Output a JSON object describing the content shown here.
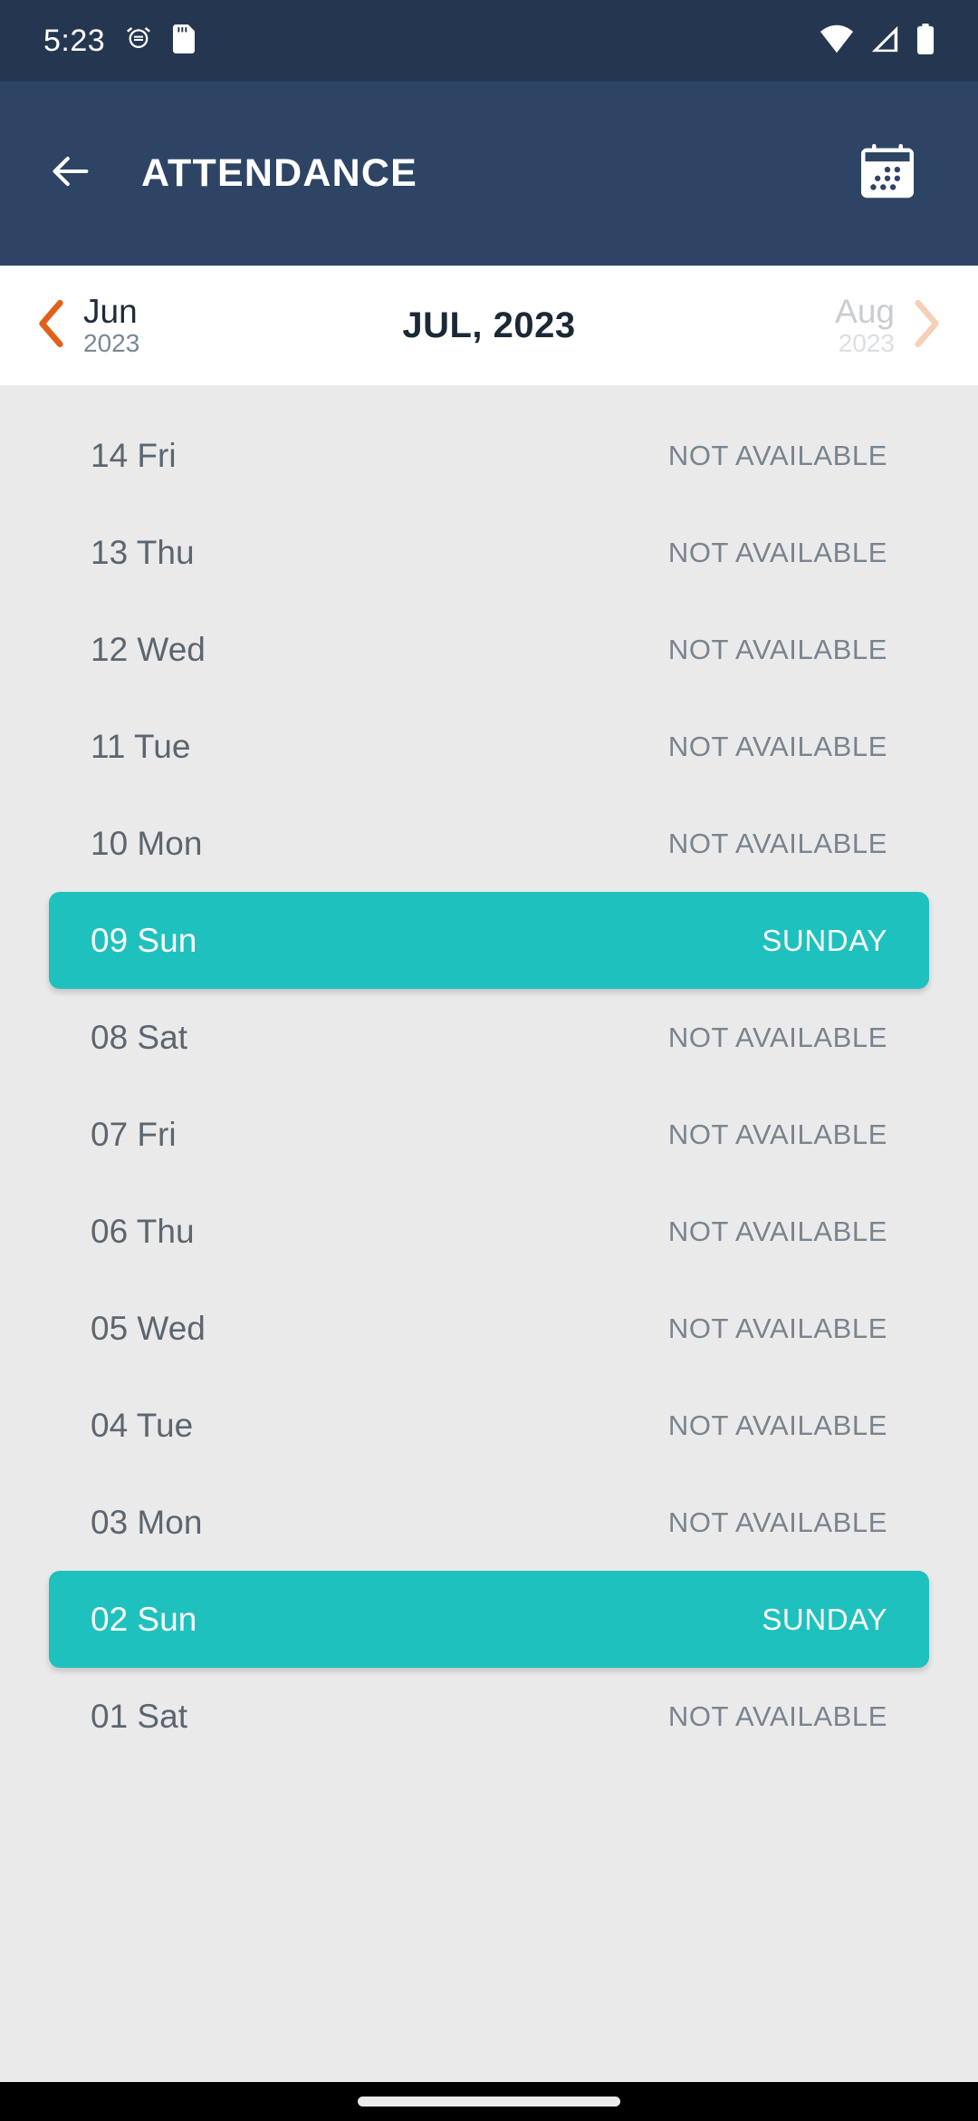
{
  "status_bar": {
    "time": "5:23",
    "icons": [
      "alarm-clock-icon",
      "sd-card-icon"
    ],
    "right_icons": [
      "wifi-icon",
      "cellular-signal-icon",
      "battery-icon"
    ],
    "background_color": "#253750"
  },
  "app_bar": {
    "title": "ATTENDANCE",
    "back_icon": "back-arrow-icon",
    "action_icon": "calendar-icon",
    "background_color": "#2e4465"
  },
  "month_nav": {
    "prev": {
      "name": "Jun",
      "year": "2023",
      "icon": "chevron-left-icon"
    },
    "current": "JUL, 2023",
    "next": {
      "name": "Aug",
      "year": "2023",
      "icon": "chevron-right-icon"
    },
    "accent_color": "#e2601a",
    "next_accent_color": "#f7cfb9"
  },
  "colors": {
    "holiday": "#1fc1be",
    "list_background": "#ebeaea",
    "date_text": "#5b6670",
    "status_text": "#78848f"
  },
  "day_list": [
    {
      "date": "14 Fri",
      "status": "NOT AVAILABLE",
      "holiday": false
    },
    {
      "date": "13 Thu",
      "status": "NOT AVAILABLE",
      "holiday": false
    },
    {
      "date": "12 Wed",
      "status": "NOT AVAILABLE",
      "holiday": false
    },
    {
      "date": "11 Tue",
      "status": "NOT AVAILABLE",
      "holiday": false
    },
    {
      "date": "10 Mon",
      "status": "NOT AVAILABLE",
      "holiday": false
    },
    {
      "date": "09 Sun",
      "status": "SUNDAY",
      "holiday": true
    },
    {
      "date": "08 Sat",
      "status": "NOT AVAILABLE",
      "holiday": false
    },
    {
      "date": "07 Fri",
      "status": "NOT AVAILABLE",
      "holiday": false
    },
    {
      "date": "06 Thu",
      "status": "NOT AVAILABLE",
      "holiday": false
    },
    {
      "date": "05 Wed",
      "status": "NOT AVAILABLE",
      "holiday": false
    },
    {
      "date": "04 Tue",
      "status": "NOT AVAILABLE",
      "holiday": false
    },
    {
      "date": "03 Mon",
      "status": "NOT AVAILABLE",
      "holiday": false
    },
    {
      "date": "02 Sun",
      "status": "SUNDAY",
      "holiday": true
    },
    {
      "date": "01 Sat",
      "status": "NOT AVAILABLE",
      "holiday": false
    }
  ],
  "nav_bar": {
    "gesture_pill": "home-gesture-pill"
  }
}
